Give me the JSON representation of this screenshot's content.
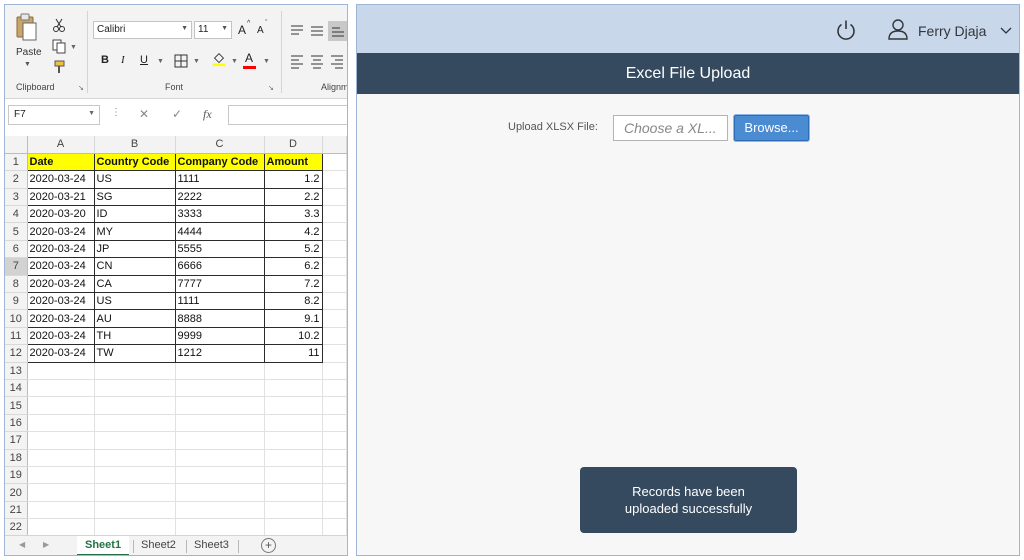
{
  "excel": {
    "ribbon": {
      "clipboard": {
        "paste_label": "Paste",
        "group_label": "Clipboard"
      },
      "font": {
        "font_name": "Calibri",
        "font_size": "11",
        "grow_label": "A",
        "shrink_label": "A",
        "bold": "B",
        "italic": "I",
        "underline": "U",
        "font_color_label": "A",
        "group_label": "Font"
      },
      "alignment": {
        "group_label": "Alignm"
      }
    },
    "formula_bar": {
      "name_box": "F7",
      "fx_label": "fx"
    },
    "columns": [
      "A",
      "B",
      "C",
      "D"
    ],
    "header_row": [
      "Date",
      "Country Code",
      "Company Code",
      "Amount"
    ],
    "rows": [
      [
        "2020-03-24",
        "US",
        "1111",
        "1.2"
      ],
      [
        "2020-03-21",
        "SG",
        "2222",
        "2.2"
      ],
      [
        "2020-03-20",
        "ID",
        "3333",
        "3.3"
      ],
      [
        "2020-03-24",
        "MY",
        "4444",
        "4.2"
      ],
      [
        "2020-03-24",
        "JP",
        "5555",
        "5.2"
      ],
      [
        "2020-03-24",
        "CN",
        "6666",
        "6.2"
      ],
      [
        "2020-03-24",
        "CA",
        "7777",
        "7.2"
      ],
      [
        "2020-03-24",
        "US",
        "1111",
        "8.2"
      ],
      [
        "2020-03-24",
        "AU",
        "8888",
        "9.1"
      ],
      [
        "2020-03-24",
        "TH",
        "9999",
        "10.2"
      ],
      [
        "2020-03-24",
        "TW",
        "1212",
        "11"
      ]
    ],
    "row_numbers": [
      "1",
      "2",
      "3",
      "4",
      "5",
      "6",
      "7",
      "8",
      "9",
      "10",
      "11",
      "12",
      "13",
      "14",
      "15",
      "16",
      "17",
      "18",
      "19",
      "20",
      "21",
      "22"
    ],
    "selected_row": "7",
    "sheets": [
      "Sheet1",
      "Sheet2",
      "Sheet3"
    ],
    "active_sheet": "Sheet1",
    "add_sheet_label": "+"
  },
  "app": {
    "user_name": "Ferry Djaja",
    "page_title": "Excel File Upload",
    "upload_label": "Upload XLSX File:",
    "file_placeholder": "Choose a XL...",
    "browse_label": "Browse...",
    "toast_line1": "Records have been",
    "toast_line2": "uploaded successfully",
    "shellbar_color": "#c8d8ea",
    "title_bar_color": "#354a5f",
    "accent_color": "#4a8bd1"
  }
}
